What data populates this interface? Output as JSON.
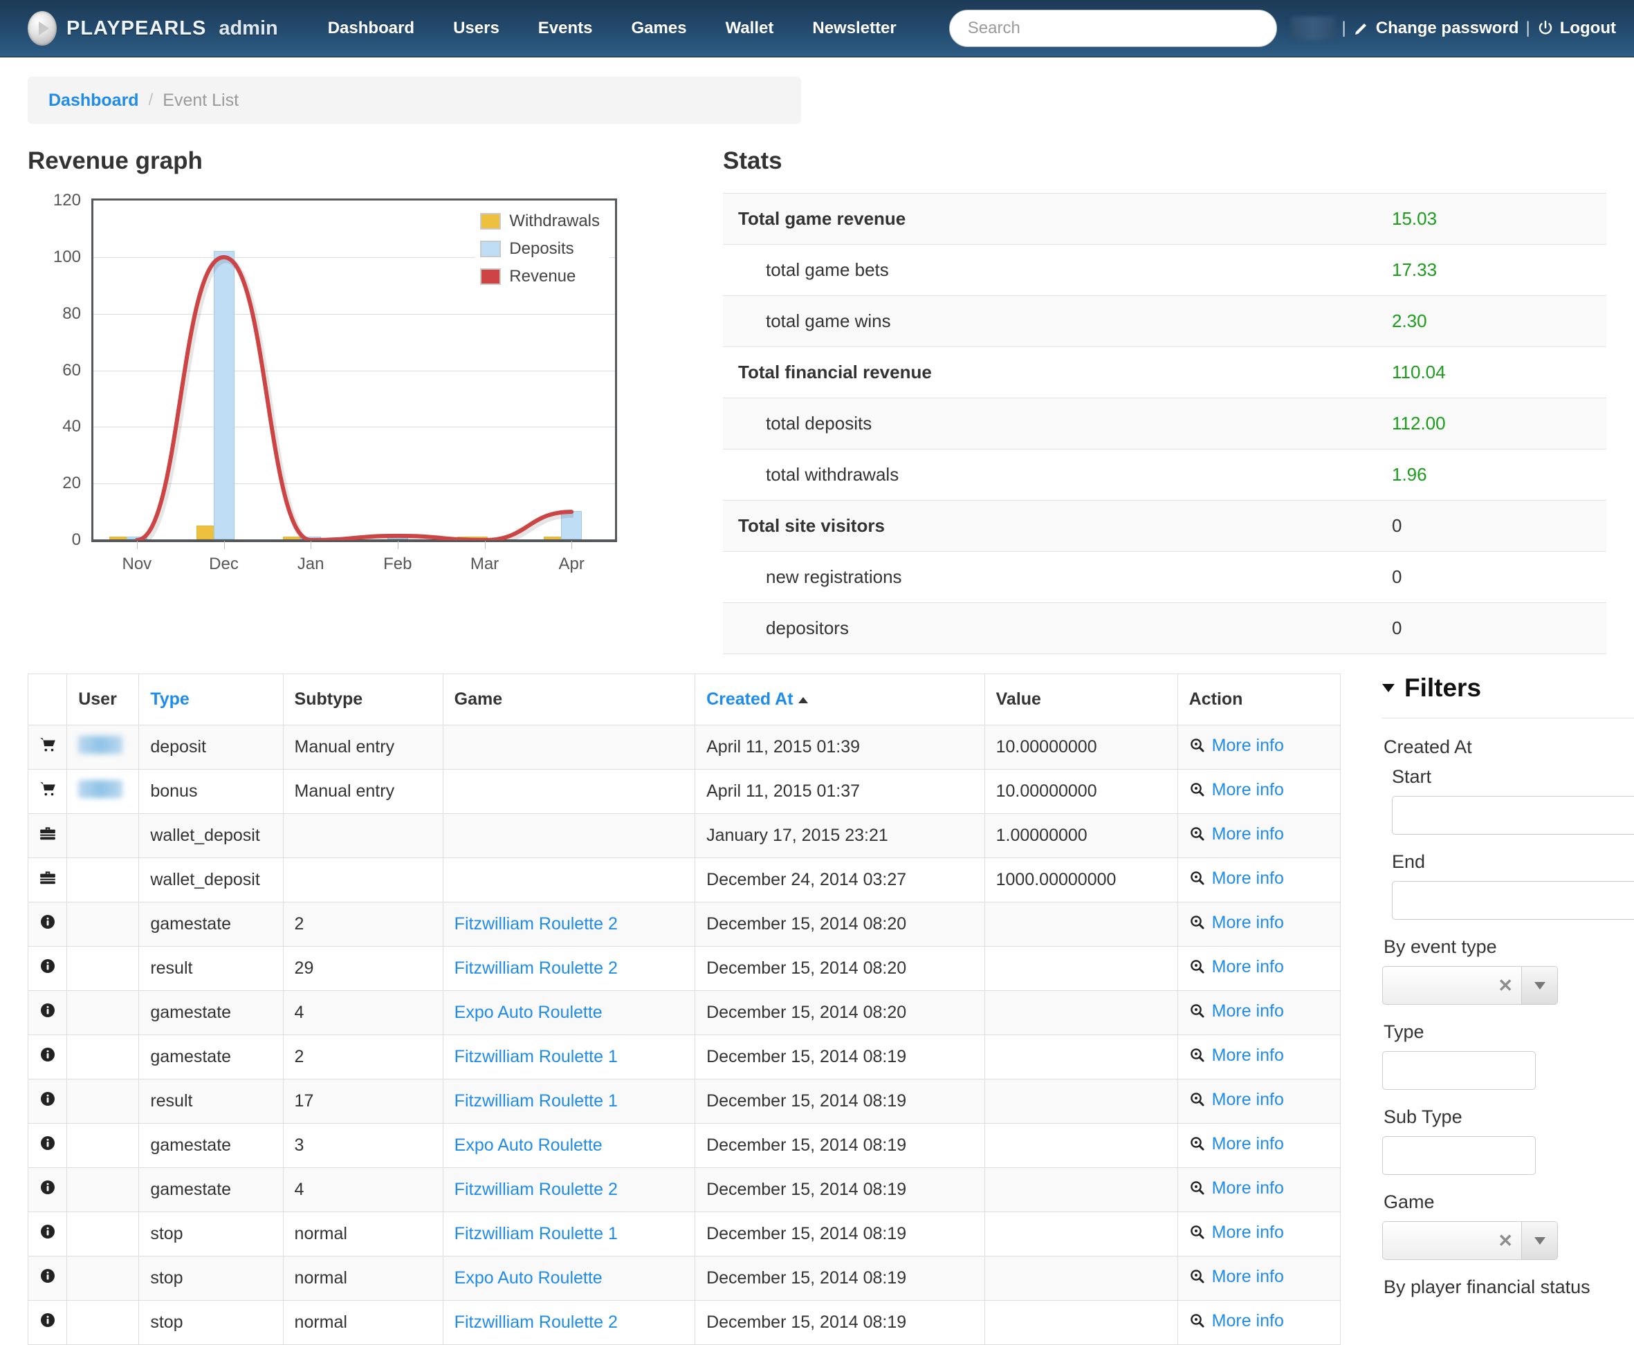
{
  "navbar": {
    "brand_name": "PLAYPEARLS",
    "brand_sub": "admin",
    "links": [
      {
        "label": "Dashboard"
      },
      {
        "label": "Users"
      },
      {
        "label": "Events"
      },
      {
        "label": "Games"
      },
      {
        "label": "Wallet"
      },
      {
        "label": "Newsletter"
      }
    ],
    "search_placeholder": "Search",
    "search_value": "",
    "username_redacted": "",
    "separator": "|",
    "change_password": "Change password",
    "logout": "Logout"
  },
  "breadcrumb": {
    "root": "Dashboard",
    "divider": "/",
    "current": "Event List"
  },
  "revenue_panel": {
    "title": "Revenue graph"
  },
  "stats_panel": {
    "title": "Stats",
    "rows": [
      {
        "label": "Total game revenue",
        "value": "15.03",
        "bold": true,
        "green": true
      },
      {
        "label": "total game bets",
        "value": "17.33",
        "bold": false,
        "green": true
      },
      {
        "label": "total game wins",
        "value": "2.30",
        "bold": false,
        "green": true
      },
      {
        "label": "Total financial revenue",
        "value": "110.04",
        "bold": true,
        "green": true
      },
      {
        "label": "total deposits",
        "value": "112.00",
        "bold": false,
        "green": true
      },
      {
        "label": "total withdrawals",
        "value": "1.96",
        "bold": false,
        "green": true
      },
      {
        "label": "Total site visitors",
        "value": "0",
        "bold": true,
        "green": false
      },
      {
        "label": "new registrations",
        "value": "0",
        "bold": false,
        "green": false
      },
      {
        "label": "depositors",
        "value": "0",
        "bold": false,
        "green": false
      }
    ]
  },
  "chart_data": {
    "type": "line",
    "title": "Revenue graph",
    "xlabel": "",
    "ylabel": "",
    "ylim": [
      0,
      120
    ],
    "yticks": [
      0,
      20,
      40,
      60,
      80,
      100,
      120
    ],
    "grid": true,
    "legend_position": "top-right",
    "categories": [
      "Nov",
      "Dec",
      "Jan",
      "Feb",
      "Mar",
      "Apr"
    ],
    "series": [
      {
        "name": "Withdrawals",
        "type": "bar",
        "color": "#edc040",
        "values": [
          0.9,
          5.0,
          0.9,
          0.0,
          0.9,
          0.9
        ]
      },
      {
        "name": "Deposits",
        "type": "bar",
        "color": "#bfdef5",
        "values": [
          1.0,
          102.0,
          0.7,
          0.7,
          0.0,
          10.0
        ]
      },
      {
        "name": "Revenue",
        "type": "line",
        "color": "#cc4444",
        "values": [
          0.0,
          100.0,
          0.0,
          1.5,
          0.0,
          10.0
        ]
      }
    ]
  },
  "events_table": {
    "columns": [
      {
        "key": "icon",
        "label": "",
        "sortable": false
      },
      {
        "key": "user",
        "label": "User",
        "sortable": false
      },
      {
        "key": "type",
        "label": "Type",
        "sortable": true
      },
      {
        "key": "subtype",
        "label": "Subtype",
        "sortable": false
      },
      {
        "key": "game",
        "label": "Game",
        "sortable": false
      },
      {
        "key": "created_at",
        "label": "Created At",
        "sortable": true,
        "sort_dir": "asc"
      },
      {
        "key": "value",
        "label": "Value",
        "sortable": false
      },
      {
        "key": "action",
        "label": "Action",
        "sortable": false
      }
    ],
    "action_label": "More info",
    "rows": [
      {
        "icon": "cart-icon",
        "user_redacted": true,
        "type": "deposit",
        "subtype": "Manual entry",
        "game": "",
        "created_at": "April 11, 2015 01:39",
        "value": "10.00000000"
      },
      {
        "icon": "cart-icon",
        "user_redacted": true,
        "type": "bonus",
        "subtype": "Manual entry",
        "game": "",
        "created_at": "April 11, 2015 01:37",
        "value": "10.00000000"
      },
      {
        "icon": "briefcase-icon",
        "user_redacted": false,
        "type": "wallet_deposit",
        "subtype": "",
        "game": "",
        "created_at": "January 17, 2015 23:21",
        "value": "1.00000000"
      },
      {
        "icon": "briefcase-icon",
        "user_redacted": false,
        "type": "wallet_deposit",
        "subtype": "",
        "game": "",
        "created_at": "December 24, 2014 03:27",
        "value": "1000.00000000"
      },
      {
        "icon": "info-icon",
        "user_redacted": false,
        "type": "gamestate",
        "subtype": "2",
        "game": "Fitzwilliam Roulette 2",
        "created_at": "December 15, 2014 08:20",
        "value": ""
      },
      {
        "icon": "info-icon",
        "user_redacted": false,
        "type": "result",
        "subtype": "29",
        "game": "Fitzwilliam Roulette 2",
        "created_at": "December 15, 2014 08:20",
        "value": ""
      },
      {
        "icon": "info-icon",
        "user_redacted": false,
        "type": "gamestate",
        "subtype": "4",
        "game": "Expo Auto Roulette",
        "created_at": "December 15, 2014 08:20",
        "value": ""
      },
      {
        "icon": "info-icon",
        "user_redacted": false,
        "type": "gamestate",
        "subtype": "2",
        "game": "Fitzwilliam Roulette 1",
        "created_at": "December 15, 2014 08:19",
        "value": ""
      },
      {
        "icon": "info-icon",
        "user_redacted": false,
        "type": "result",
        "subtype": "17",
        "game": "Fitzwilliam Roulette 1",
        "created_at": "December 15, 2014 08:19",
        "value": ""
      },
      {
        "icon": "info-icon",
        "user_redacted": false,
        "type": "gamestate",
        "subtype": "3",
        "game": "Expo Auto Roulette",
        "created_at": "December 15, 2014 08:19",
        "value": ""
      },
      {
        "icon": "info-icon",
        "user_redacted": false,
        "type": "gamestate",
        "subtype": "4",
        "game": "Fitzwilliam Roulette 2",
        "created_at": "December 15, 2014 08:19",
        "value": ""
      },
      {
        "icon": "info-icon",
        "user_redacted": false,
        "type": "stop",
        "subtype": "normal",
        "game": "Fitzwilliam Roulette 1",
        "created_at": "December 15, 2014 08:19",
        "value": ""
      },
      {
        "icon": "info-icon",
        "user_redacted": false,
        "type": "stop",
        "subtype": "normal",
        "game": "Expo Auto Roulette",
        "created_at": "December 15, 2014 08:19",
        "value": ""
      },
      {
        "icon": "info-icon",
        "user_redacted": false,
        "type": "stop",
        "subtype": "normal",
        "game": "Fitzwilliam Roulette 2",
        "created_at": "December 15, 2014 08:19",
        "value": ""
      }
    ]
  },
  "filters": {
    "title": "Filters",
    "created_at_label": "Created At",
    "start_label": "Start",
    "start_value": "",
    "end_label": "End",
    "end_value": "",
    "event_type_label": "By event type",
    "event_type_value": "",
    "type_label": "Type",
    "type_value": "",
    "subtype_label": "Sub Type",
    "subtype_value": "",
    "game_label": "Game",
    "game_value": "",
    "player_financial_status_label": "By player financial status",
    "clear_glyph": "✕"
  }
}
